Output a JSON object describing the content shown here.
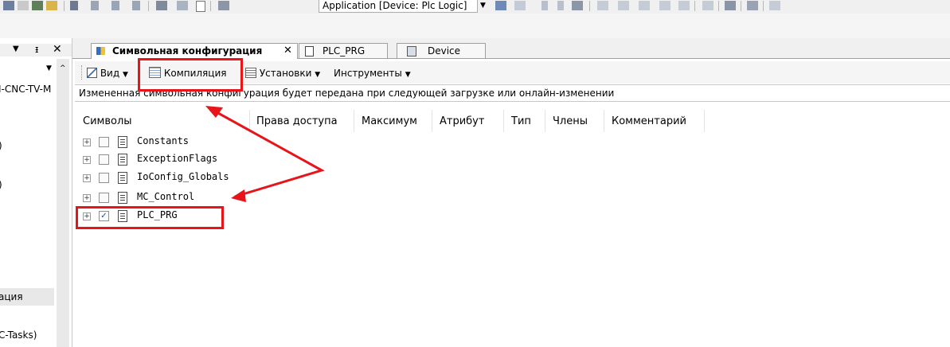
{
  "toolbar": {
    "app_combo": "Application [Device: Plc Logic]"
  },
  "left_pane": {
    "rows": [
      "I-CNC-TV-M",
      ")",
      ")",
      "ация",
      "C-Tasks)"
    ]
  },
  "tabs": [
    {
      "label": "Символьная конфигурация",
      "active": true
    },
    {
      "label": "PLC_PRG",
      "active": false
    },
    {
      "label": "Device",
      "active": false
    }
  ],
  "content_toolbar": {
    "view": "Вид",
    "compile": "Компиляция",
    "settings": "Установки",
    "tools": "Инструменты"
  },
  "info_message": "Измененная символьная конфигурация будет передана при следующей загрузке или онлайн-изменении",
  "columns": [
    "Символы",
    "Права доступа",
    "Максимум",
    "Атрибут",
    "Тип",
    "Члены",
    "Комментарий"
  ],
  "symbols": [
    {
      "name": "Constants",
      "checked": false
    },
    {
      "name": "ExceptionFlags",
      "checked": false
    },
    {
      "name": "IoConfig_Globals",
      "checked": false
    },
    {
      "name": "MC_Control",
      "checked": false
    },
    {
      "name": "PLC_PRG",
      "checked": true
    }
  ],
  "colors": {
    "highlight": "#e8141a"
  }
}
